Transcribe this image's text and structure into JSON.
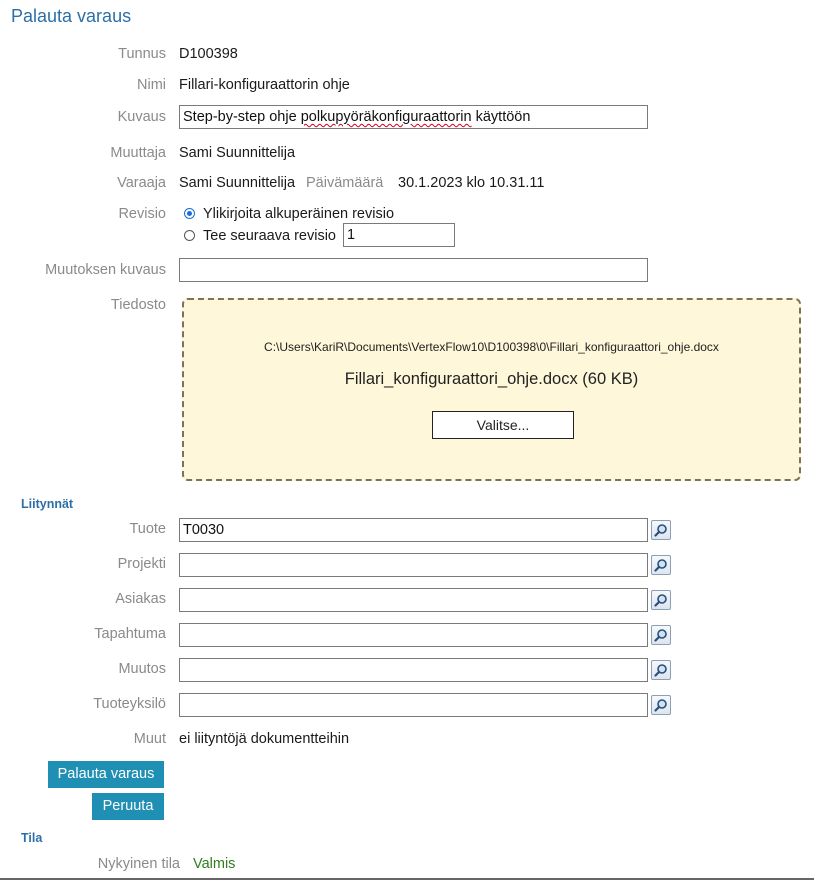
{
  "page": {
    "title": "Palauta varaus"
  },
  "fields": {
    "tunnus": {
      "label": "Tunnus",
      "value": "D100398"
    },
    "nimi": {
      "label": "Nimi",
      "value": "Fillari-konfiguraattorin ohje"
    },
    "kuvaus": {
      "label": "Kuvaus",
      "value_prefix": "Step-by-step ohje ",
      "value_misspelled": "polkupyöräkonfiguraattorin",
      "value_suffix": " käyttöön"
    },
    "muuttaja": {
      "label": "Muuttaja",
      "value": "Sami Suunnittelija"
    },
    "varaaja": {
      "label": "Varaaja",
      "value": "Sami Suunnittelija",
      "date_label": "Päivämäärä",
      "date_value": "30.1.2023 klo 10.31.11"
    },
    "revisio": {
      "label": "Revisio",
      "option_overwrite": "Ylikirjoita alkuperäinen revisio",
      "option_next": "Tee seuraava revisio",
      "next_value": "1",
      "selected": "overwrite"
    },
    "muutoksen_kuvaus": {
      "label": "Muutoksen kuvaus",
      "value": ""
    },
    "tiedosto": {
      "label": "Tiedosto",
      "path": "C:\\Users\\KariR\\Documents\\VertexFlow10\\D100398\\0\\Fillari_konfiguraattori_ohje.docx",
      "file_display": "Fillari_konfiguraattori_ohje.docx (60 KB)",
      "choose_label": "Valitse..."
    }
  },
  "liitynnat": {
    "heading": "Liitynnät",
    "rows": [
      {
        "label": "Tuote",
        "value": "T0030",
        "icon": "search-icon"
      },
      {
        "label": "Projekti",
        "value": "",
        "icon": "search-icon"
      },
      {
        "label": "Asiakas",
        "value": "",
        "icon": "search-icon"
      },
      {
        "label": "Tapahtuma",
        "value": "",
        "icon": "search-icon"
      },
      {
        "label": "Muutos",
        "value": "",
        "icon": "search-icon"
      },
      {
        "label": "Tuoteyksilö",
        "value": "",
        "icon": "search-icon"
      }
    ],
    "muut_label": "Muut",
    "muut_value": "ei liityntöjä dokumentteihin"
  },
  "actions": {
    "submit_label": "Palauta varaus",
    "cancel_label": "Peruuta"
  },
  "tila": {
    "heading": "Tila",
    "current_label": "Nykyinen tila",
    "current_value": "Valmis"
  },
  "colors": {
    "title": "#2c6fa8",
    "button": "#1f8fb3",
    "drop_bg": "#fef7d9",
    "status_ok": "#2e7d1e"
  }
}
